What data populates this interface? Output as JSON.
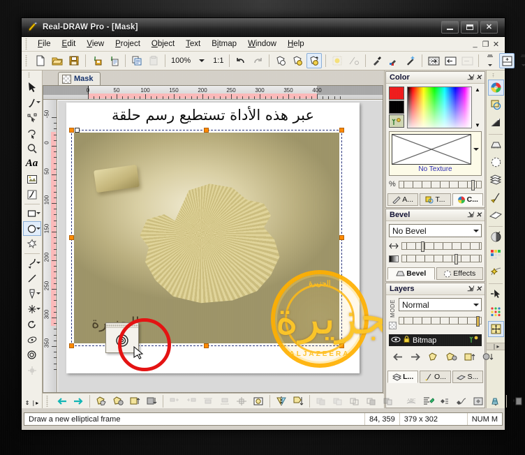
{
  "window": {
    "title": "Real-DRAW Pro - [Mask]",
    "app_icon": "pen-icon",
    "buttons": {
      "minimize": "minimize-icon",
      "maximize": "maximize-icon",
      "close": "close-icon"
    }
  },
  "menu": {
    "items": [
      {
        "label": "File",
        "accel": "F"
      },
      {
        "label": "Edit",
        "accel": "E"
      },
      {
        "label": "View",
        "accel": "V"
      },
      {
        "label": "Project",
        "accel": "P"
      },
      {
        "label": "Object",
        "accel": "O"
      },
      {
        "label": "Text",
        "accel": "T"
      },
      {
        "label": "Bitmap",
        "accel": "B"
      },
      {
        "label": "Window",
        "accel": "W"
      },
      {
        "label": "Help",
        "accel": "H"
      }
    ],
    "mdi_controls": [
      "minimize",
      "restore",
      "close"
    ]
  },
  "toolbar": {
    "zoom_value": "100%",
    "ratio_label": "1:1",
    "items": [
      "new-document-icon",
      "open-folder-icon",
      "save-disk-icon",
      "import-icon",
      "export-icon",
      "copy-icon",
      "paste-icon",
      "zoom-combo",
      "ratio-1to1",
      "undo-icon",
      "redo-icon",
      "object-front-icon",
      "object-fill-icon",
      "object-new-icon",
      "dither-icon",
      "cut-path-icon",
      "eyedropper-icon",
      "color-picker-icon",
      "magic-wand-icon",
      "transparency-icon",
      "align-left-icon",
      "align-right-icon",
      "spinner-icon",
      "add-panel-icon",
      "spinner2-icon"
    ]
  },
  "document": {
    "tab_label": "Mask",
    "tab_icon": "mask-thumbnail-icon",
    "h_ruler_labels": [
      "0",
      "50",
      "100",
      "150",
      "200",
      "250",
      "300",
      "350",
      "400"
    ],
    "v_ruler_labels": [
      "-50",
      "0",
      "50",
      "100",
      "150",
      "200",
      "250",
      "300",
      "350"
    ],
    "canvas": {
      "arabic_caption": "عبر هذه الأداة تستطيع رسم حلقة",
      "watermark_glyph": "الجزيرة",
      "logo": {
        "top_text": "الجزيرة",
        "bottom_text": "ALJAZEERA",
        "glyph": "الجزيرة"
      }
    },
    "annotation": {
      "shape": "red-circle-highlight",
      "tool_icon": "elliptical-frame-icon"
    }
  },
  "left_tools": [
    {
      "name": "select-arrow-tool",
      "icon": "arrow-icon",
      "selected": false,
      "dropdown": false
    },
    {
      "name": "brush-tool",
      "icon": "brush-icon",
      "selected": false,
      "dropdown": true
    },
    {
      "name": "node-edit-tool",
      "icon": "node-edit-icon",
      "selected": false,
      "dropdown": false
    },
    {
      "name": "lasso-tool",
      "icon": "lasso-icon",
      "selected": false,
      "dropdown": false
    },
    {
      "name": "zoom-tool",
      "icon": "magnifier-icon",
      "selected": false,
      "dropdown": false
    },
    {
      "name": "text-tool",
      "icon": "text-aa-icon",
      "selected": false,
      "dropdown": false
    },
    {
      "name": "picture-tool",
      "icon": "picture-icon",
      "selected": false,
      "dropdown": false
    },
    {
      "name": "paint-tool",
      "icon": "paint-icon",
      "selected": false,
      "dropdown": false
    },
    {
      "name": "rectangle-tool",
      "icon": "rectangle-icon",
      "selected": false,
      "dropdown": true
    },
    {
      "name": "ellipse-tool",
      "icon": "ellipse-icon",
      "selected": true,
      "dropdown": true
    },
    {
      "name": "star-tool",
      "icon": "star-icon",
      "selected": false,
      "dropdown": false
    },
    {
      "name": "curve-tool",
      "icon": "curve-arrow-icon",
      "selected": false,
      "dropdown": true
    },
    {
      "name": "line-tool",
      "icon": "line-icon",
      "selected": false,
      "dropdown": false
    },
    {
      "name": "gradient-tool",
      "icon": "gradient-icon",
      "selected": false,
      "dropdown": true
    },
    {
      "name": "light-tool",
      "icon": "light-star-icon",
      "selected": false,
      "dropdown": true
    },
    {
      "name": "rotate-tool",
      "icon": "rotate-icon",
      "selected": false,
      "dropdown": false
    },
    {
      "name": "perspective-tool",
      "icon": "perspective-icon",
      "selected": false,
      "dropdown": false
    },
    {
      "name": "elliptical-frame-tool",
      "icon": "target-circle-icon",
      "selected": false,
      "dropdown": false
    },
    {
      "name": "move-node-tool",
      "icon": "move-node-icon",
      "selected": false,
      "dropdown": false
    }
  ],
  "panels": {
    "color": {
      "title": "Color",
      "pin_icon": "pin-icon",
      "close_icon": "close-icon",
      "foreground_color": "#ef1c1c",
      "background_color": "#000000",
      "nature_icon": "nature-swatch-icon",
      "texture_label": "No Texture",
      "opacity_symbol": "%",
      "tabs": [
        {
          "label": "A...",
          "icon": "attributes-icon",
          "active": false
        },
        {
          "label": "T...",
          "icon": "transform-icon",
          "active": false
        },
        {
          "label": "C...",
          "icon": "color-wheel-icon",
          "active": true
        }
      ]
    },
    "bevel": {
      "title": "Bevel",
      "pin_icon": "pin-icon",
      "close_icon": "close-icon",
      "preset": "No Bevel",
      "slider1_icon": "width-arrows-icon",
      "slider2_icon": "gradient-strip-icon",
      "tabs": [
        {
          "label": "Bevel",
          "icon": "bevel-icon",
          "active": true
        },
        {
          "label": "Effects",
          "icon": "effects-icon",
          "active": false
        }
      ]
    },
    "layers": {
      "title": "Layers",
      "pin_icon": "pin-icon",
      "close_icon": "close-icon",
      "mode_label": "MODE",
      "blend_mode": "Normal",
      "opacity_icon": "checker-icon",
      "layer": {
        "name": "Bitmap",
        "eye_icon": "eye-icon",
        "lock_icon": "lock-icon",
        "fx_icon": "nature-swatch-icon"
      },
      "buttons": [
        "move-left-icon",
        "move-right-icon",
        "duplicate-icon",
        "group-icon",
        "raise-icon",
        "lower-icon"
      ],
      "tabs": [
        {
          "label": "L...",
          "icon": "layers-icon",
          "active": true
        },
        {
          "label": "O...",
          "icon": "objects-icon",
          "active": false
        },
        {
          "label": "S...",
          "icon": "styles-icon",
          "active": false
        }
      ]
    }
  },
  "icon_strip": [
    "color-wheel-icon",
    "fill-shape-icon",
    "gradient-ramp-icon",
    "bevel-icon",
    "effects-circle-icon",
    "layers-icon",
    "objects-icon",
    "styles-icon",
    "mask-icon",
    "palette-grid-icon",
    "magic-fx-icon",
    "pointer-minus-icon",
    "dots-grid-icon",
    "transform-handles-icon",
    "expand-arrows-icon"
  ],
  "canvas_toolbar": [
    "nudge-left-icon",
    "nudge-right-icon",
    "duplicate-object-icon",
    "group-objects-icon",
    "bring-forward-icon",
    "send-backward-icon",
    "align-left-edge-icon",
    "align-right-edge-icon",
    "align-top-edge-icon",
    "align-bottom-edge-icon",
    "align-center-icon",
    "center-object-icon",
    "flip-horizontal-icon",
    "flip-vertical-icon",
    "combine-icon",
    "subtract-icon",
    "intersect-icon",
    "exclude-icon",
    "trim-icon",
    "weld-icon",
    "text-fit-icon",
    "sort-objects-icon",
    "node-join-icon",
    "node-curve-icon",
    "clip-icon",
    "perspective-box-icon",
    "add-mask-icon",
    "add-light-icon",
    "scroll-up-down-icon"
  ],
  "status": {
    "hint": "Draw a new elliptical frame",
    "coordinates": "84, 359",
    "size": "379 x 302",
    "indicators": "NUM M"
  }
}
